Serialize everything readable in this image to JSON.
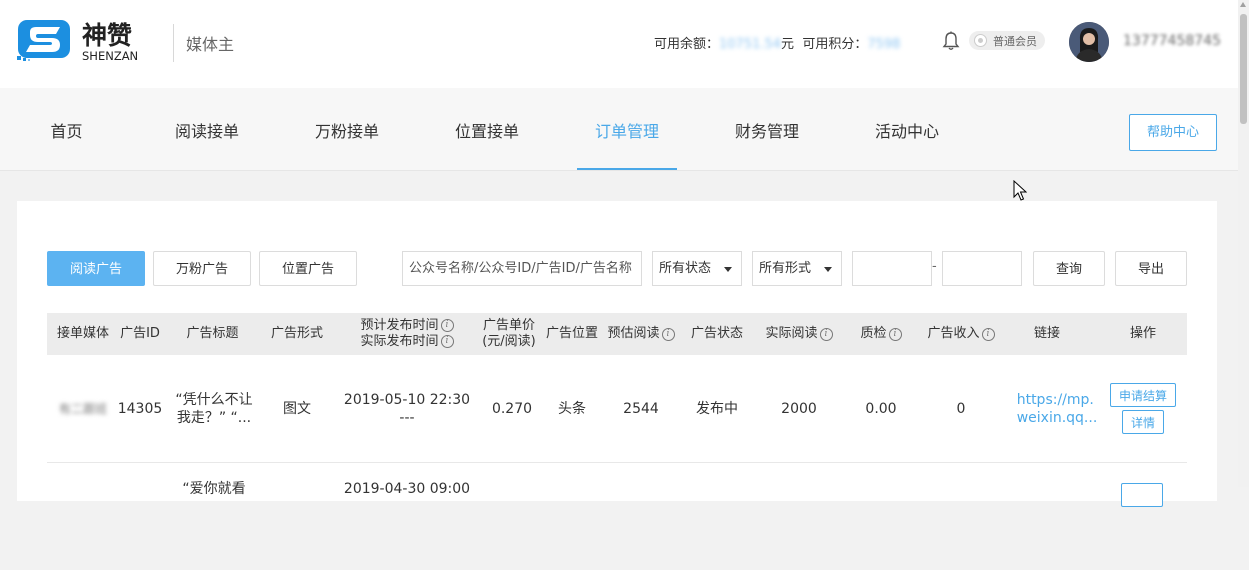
{
  "brand": {
    "name_cn": "神赞",
    "name_en": "SHENZAN",
    "role": "媒体主"
  },
  "account": {
    "balance_label": "可用余额：",
    "balance_value": "10751.54",
    "balance_unit": "元",
    "points_label": "可用积分：",
    "points_value": "7598",
    "member_level": "普通会员",
    "phone": "13777458745"
  },
  "nav": {
    "items": [
      {
        "label": "首页"
      },
      {
        "label": "阅读接单"
      },
      {
        "label": "万粉接单"
      },
      {
        "label": "位置接单"
      },
      {
        "label": "订单管理"
      },
      {
        "label": "财务管理"
      },
      {
        "label": "活动中心"
      }
    ],
    "active": "订单管理",
    "help_label": "帮助中心"
  },
  "filters": {
    "ad_types": [
      "阅读广告",
      "万粉广告",
      "位置广告"
    ],
    "active_ad_type": "阅读广告",
    "search_placeholder": "公众号名称/公众号ID/广告ID/广告名称",
    "status_select": "所有状态",
    "form_select": "所有形式",
    "date_separator": "-",
    "query_label": "查询",
    "export_label": "导出"
  },
  "table": {
    "headers": {
      "media": "接单媒体",
      "ad_id": "广告ID",
      "title": "广告标题",
      "form": "广告形式",
      "time_plan": "预计发布时间",
      "time_actual": "实际发布时间",
      "price_1": "广告单价",
      "price_2": "(元/阅读)",
      "position": "广告位置",
      "est_reads": "预估阅读",
      "status": "广告状态",
      "actual_reads": "实际阅读",
      "qc": "质检",
      "income": "广告收入",
      "link": "链接",
      "ops": "操作"
    },
    "info_glyph": "i",
    "rows": [
      {
        "media": "有二跟班",
        "ad_id": "14305",
        "title_line1": "“凭什么不让",
        "title_line2": "我走？” “...",
        "form": "图文",
        "time_plan": "2019-05-10 22:30",
        "time_actual": "---",
        "price": "0.270",
        "position": "头条",
        "est_reads": "2544",
        "status": "发布中",
        "actual_reads": "2000",
        "qc": "0.00",
        "income": "0",
        "link_line1": "https://mp.",
        "link_line2": "weixin.qq...",
        "op_settle": "申请结算",
        "op_detail": "详情"
      },
      {
        "title_line1": "“爱你就看",
        "time_plan": "2019-04-30 09:00"
      }
    ]
  }
}
